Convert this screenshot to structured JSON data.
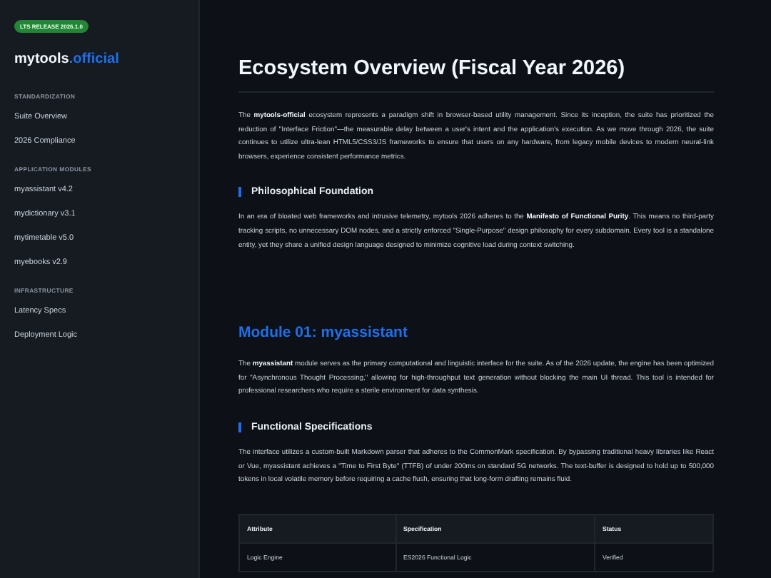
{
  "sidebar": {
    "badge": "LTS RELEASE 2026.1.0",
    "brand": {
      "name": "mytools",
      "suffix": ".official"
    },
    "sections": [
      {
        "heading": "STANDARDIZATION",
        "items": [
          "Suite Overview",
          "2026 Compliance"
        ]
      },
      {
        "heading": "APPLICATION MODULES",
        "items": [
          "myassistant v4.2",
          "mydictionary v3.1",
          "mytimetable v5.0",
          "myebooks v2.9"
        ]
      },
      {
        "heading": "INFRASTRUCTURE",
        "items": [
          "Latency Specs",
          "Deployment Logic"
        ]
      }
    ]
  },
  "main": {
    "title": "Ecosystem Overview (Fiscal Year 2026)",
    "intro": "The **mytools-official** ecosystem represents a paradigm shift in browser-based utility management. Since its inception, the suite has prioritized the reduction of \"Interface Friction\"—the measurable delay between a user's intent and the application's execution. As we move through 2026, the suite continues to utilize ultra-lean HTML5/CSS3/JS frameworks to ensure that users on any hardware, from legacy mobile devices to modern neural-link browsers, experience consistent performance metrics.",
    "sections": [
      {
        "heading": "Philosophical Foundation",
        "text": "In an era of bloated web frameworks and intrusive telemetry, mytools 2026 adheres to the **Manifesto of Functional Purity**. This means no third-party tracking scripts, no unnecessary DOM nodes, and a strictly enforced \"Single-Purpose\" design philosophy for every subdomain. Every tool is a standalone entity, yet they share a unified design language designed to minimize cognitive load during context switching."
      }
    ],
    "module": {
      "title": "Module 01: myassistant",
      "text": "The **myassistant** module serves as the primary computational and linguistic interface for the suite. As of the 2026 update, the engine has been optimized for \"Asynchronous Thought Processing,\" allowing for high-throughput text generation without blocking the main UI thread. This tool is intended for professional researchers who require a sterile environment for data synthesis.",
      "sections": [
        {
          "heading": "Functional Specifications",
          "text": "The interface utilizes a custom-built Markdown parser that adheres to the CommonMark specification. By bypassing traditional heavy libraries like React or Vue, myassistant achieves a \"Time to First Byte\" (TTFB) of under 200ms on standard 5G networks. The text-buffer is designed to hold up to 500,000 tokens in local volatile memory before requiring a cache flush, ensuring that long-form drafting remains fluid."
        }
      ],
      "table": {
        "columns": [
          "Attribute",
          "Specification",
          "Status"
        ],
        "rows": [
          [
            "Logic Engine",
            "ES2026 Functional Logic",
            "Verified"
          ]
        ]
      }
    }
  }
}
